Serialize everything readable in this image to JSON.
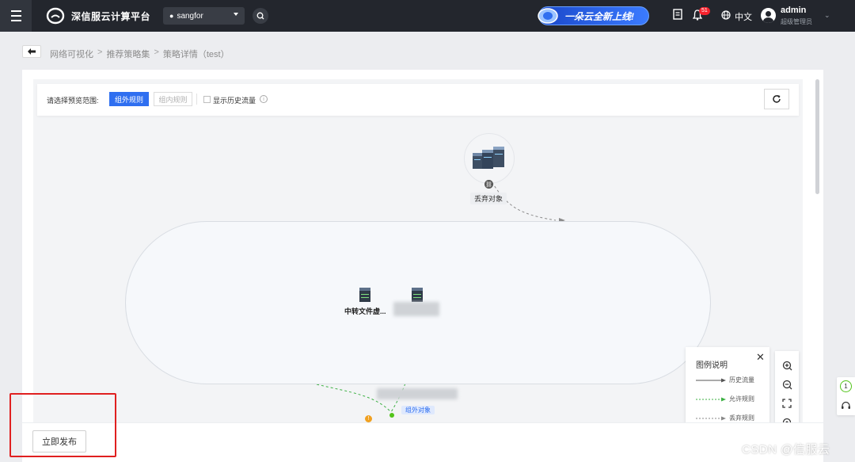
{
  "header": {
    "brand": "深信服云计算平台",
    "region": "sangfor",
    "promo": "一朵云全新上线!",
    "notification_count": "51",
    "language": "中文",
    "user_name": "admin",
    "user_role": "超级管理员"
  },
  "breadcrumb": {
    "items": [
      "网络可视化",
      "推荐策略集",
      "策略详情（test）"
    ],
    "separator": ">"
  },
  "toolbar": {
    "scope_label": "请选择预览范围:",
    "tab_outer": "组外规则",
    "tab_inner": "组内规则",
    "show_history": "显示历史流量"
  },
  "graph": {
    "discard_label": "丢弃对象",
    "node_1_label": "中转文件虚...",
    "small_tag": "组外对象"
  },
  "legend": {
    "title": "图例说明",
    "items": [
      {
        "label": "历史流量",
        "color": "#555555",
        "style": "solid"
      },
      {
        "label": "允许规则",
        "color": "#3cb043",
        "style": "dashed"
      },
      {
        "label": "丢弃规则",
        "color": "#888888",
        "style": "dashed"
      }
    ]
  },
  "footer": {
    "publish_button": "立即发布"
  },
  "float_tools": {
    "count": "1"
  },
  "watermark": "CSDN @信服云",
  "colors": {
    "primary": "#2f6ff0",
    "topbar": "#23262d",
    "highlight": "#e02020"
  }
}
